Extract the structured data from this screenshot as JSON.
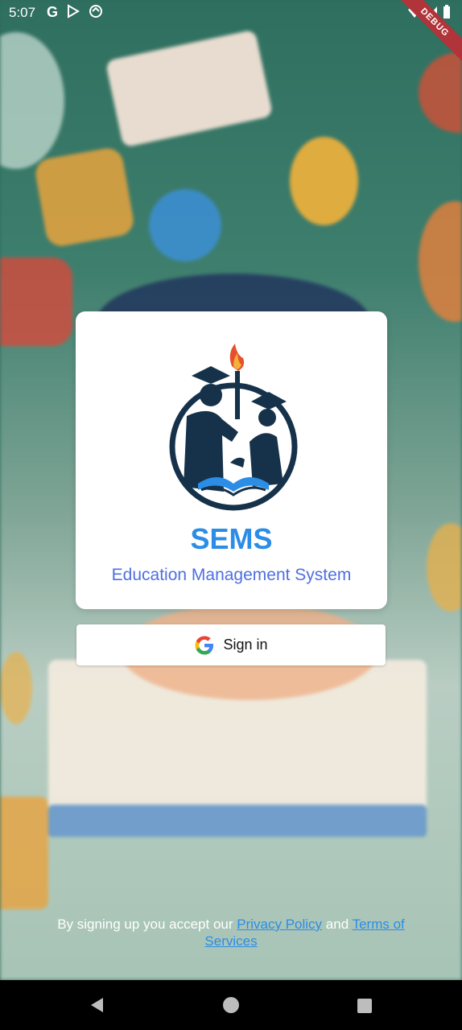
{
  "status_bar": {
    "time": "5:07",
    "icons": [
      "google-icon",
      "play-store-icon",
      "sync-icon"
    ],
    "right_icons": [
      "wifi-icon",
      "signal-icon",
      "battery-icon"
    ],
    "debug_label": "DEBUG"
  },
  "card": {
    "title": "SEMS",
    "subtitle": "Education Management System"
  },
  "signin": {
    "label": "Sign in",
    "icon": "google-g-icon"
  },
  "terms": {
    "prefix": "By signing up you accept our ",
    "privacy_link": "Privacy Policy",
    "middle": " and ",
    "terms_link": "Terms of Services"
  },
  "nav": {
    "back": "back-icon",
    "home": "home-icon",
    "recent": "recents-icon"
  },
  "colors": {
    "accent": "#2b8de6",
    "subtitle": "#4f6fe0",
    "debug_ribbon": "#b0343a"
  }
}
